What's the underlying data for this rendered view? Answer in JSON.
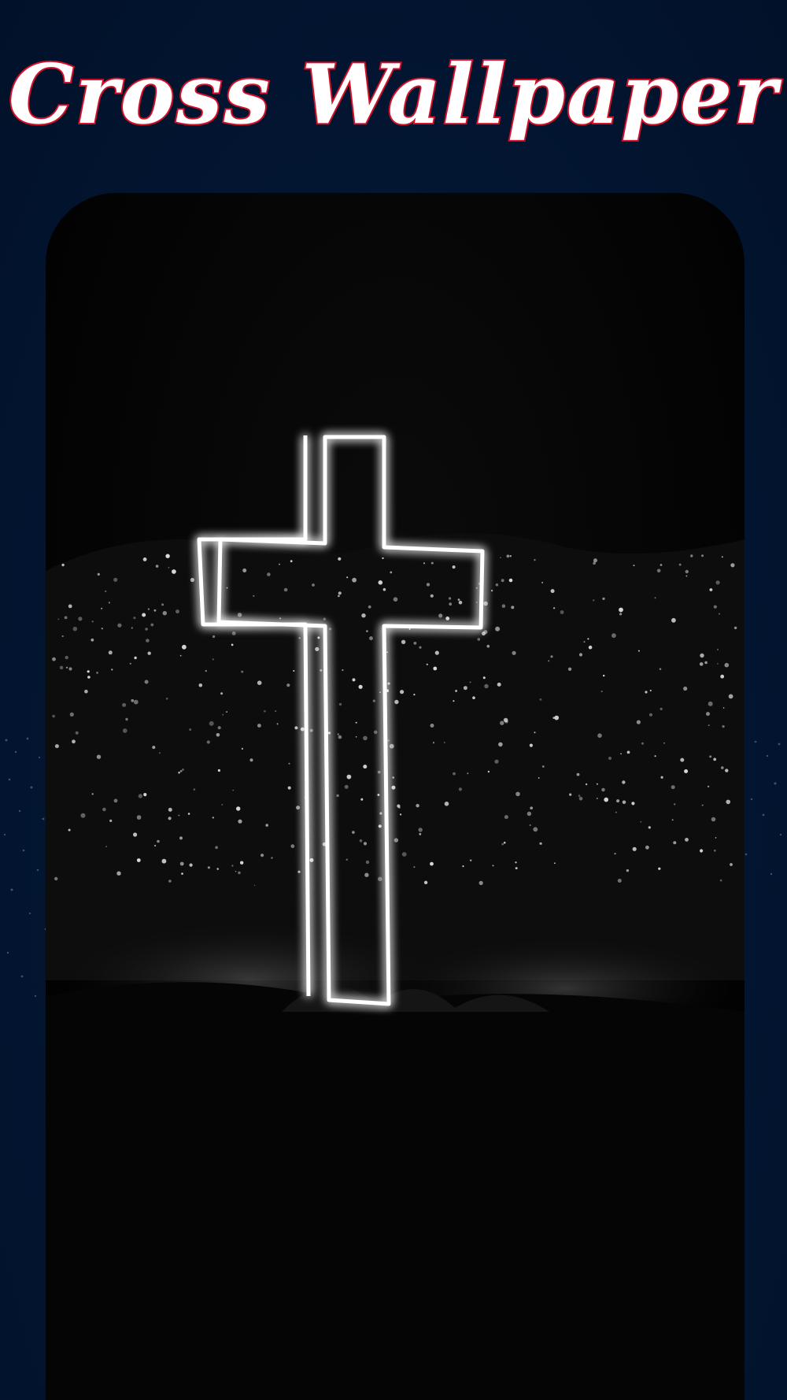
{
  "app": {
    "title": "Cross Wallpaper"
  },
  "wallpaper": {
    "subject": "cross-image"
  },
  "colors": {
    "background": "#031733",
    "title_fill": "#ffffff",
    "title_outline": "#d3112a",
    "frame": "#000000",
    "neon": "#ffffff"
  }
}
